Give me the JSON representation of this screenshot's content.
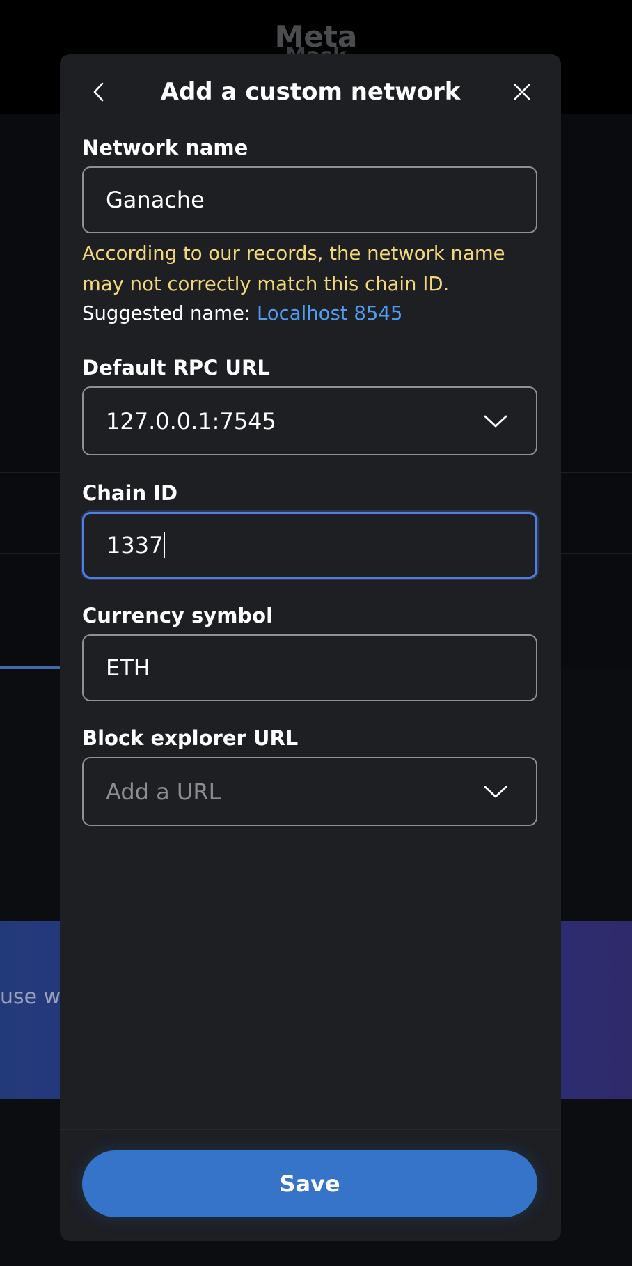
{
  "background": {
    "logo_line1": "Meta",
    "logo_line2": "Mask",
    "banner_text": "use w"
  },
  "modal": {
    "title": "Add a custom network",
    "back_icon": "chevron-left-icon",
    "close_icon": "close-icon"
  },
  "network_name": {
    "label": "Network name",
    "value": "Ganache",
    "warning": "According to our records, the network name may not correctly match this chain ID.",
    "suggested_label": "Suggested name:",
    "suggested_value": "Localhost 8545"
  },
  "rpc_url": {
    "label": "Default RPC URL",
    "value": "127.0.0.1:7545",
    "icon": "chevron-down-icon"
  },
  "chain_id": {
    "label": "Chain ID",
    "value": "1337"
  },
  "currency_symbol": {
    "label": "Currency symbol",
    "value": "ETH"
  },
  "block_explorer": {
    "label": "Block explorer URL",
    "placeholder": "Add a URL",
    "icon": "chevron-down-icon"
  },
  "footer": {
    "save_label": "Save"
  },
  "colors": {
    "accent": "#3574c9",
    "link": "#4f9cf0",
    "warning": "#f4d77a",
    "focus_border": "#4f7fe6",
    "modal_bg": "#1d1f23"
  }
}
